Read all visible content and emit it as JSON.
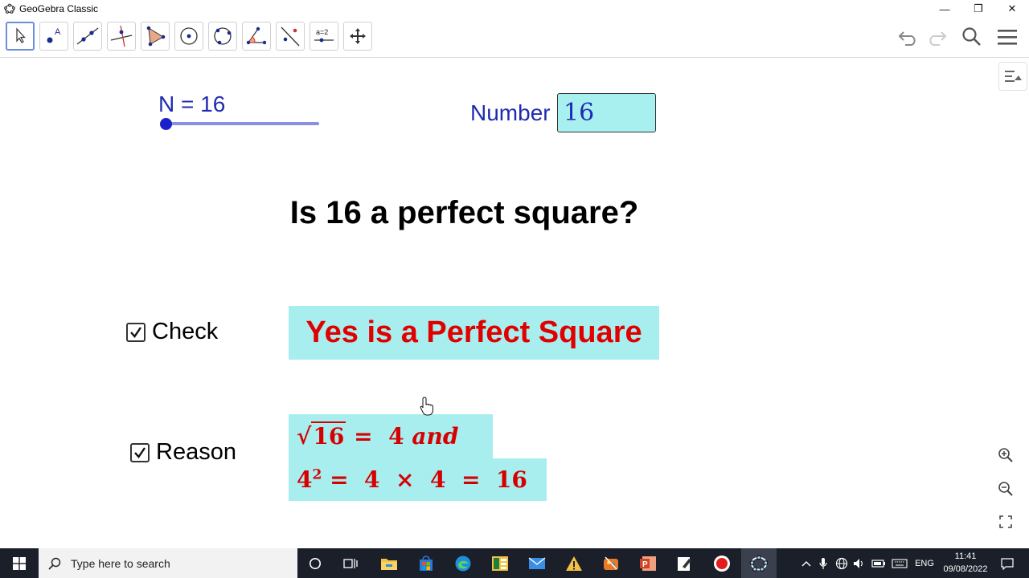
{
  "window": {
    "title": "GeoGebra Classic",
    "controls": {
      "minimize": "—",
      "restore": "❐",
      "close": "✕"
    }
  },
  "toolbar": {
    "tools": [
      {
        "name": "move-tool-icon"
      },
      {
        "name": "point-tool-icon",
        "letter": "A"
      },
      {
        "name": "line-tool-icon"
      },
      {
        "name": "perpendicular-line-tool-icon"
      },
      {
        "name": "polygon-tool-icon"
      },
      {
        "name": "circle-tool-icon"
      },
      {
        "name": "circle-three-points-tool-icon"
      },
      {
        "name": "angle-tool-icon"
      },
      {
        "name": "reflect-tool-icon"
      },
      {
        "name": "slider-tool-icon",
        "label": "a=2"
      },
      {
        "name": "move-graphics-view-tool-icon"
      }
    ],
    "right": [
      "undo-icon",
      "redo-icon",
      "search-icon",
      "menu-icon"
    ]
  },
  "graphics": {
    "slider": {
      "label": "N = 16",
      "value": 16,
      "fraction": 0
    },
    "input": {
      "label": "Number",
      "value": "16"
    },
    "question": "Is 16 a perfect square?",
    "check": {
      "label": "Check",
      "checked": true
    },
    "answer": "Yes is a Perfect Square",
    "reason": {
      "label": "Reason",
      "checked": true
    },
    "math_line1": {
      "radicand": "16",
      "rest": " =  4 ",
      "word": "and"
    },
    "math_line2": {
      "base": "4",
      "exp": "2",
      "rest": " =  4  ×  4  =  16"
    },
    "style_bar_icon": "style-bar-toggle-icon",
    "zoom": [
      "zoom-in-icon",
      "zoom-out-icon",
      "fullscreen-icon"
    ]
  },
  "taskbar": {
    "search_placeholder": "Type here to search",
    "language": "ENG",
    "time": "11:41",
    "date": "09/08/2022"
  },
  "colors": {
    "object_blue": "#1f2bb0",
    "answer_red": "#e00000",
    "highlight_cyan": "#a8eeee",
    "taskbar": "#1a1f2a"
  }
}
